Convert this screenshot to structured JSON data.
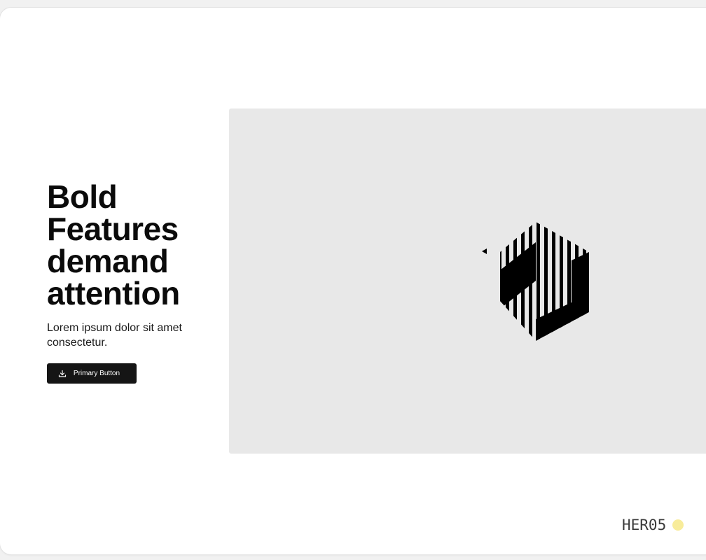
{
  "hero": {
    "headline_lines": [
      "Bold",
      "Features",
      "demand",
      "attention"
    ],
    "subtext": "Lorem ipsum dolor sit amet consectetur.",
    "primary_button_label": "Primary Button",
    "primary_button_icon": "download-icon"
  },
  "media": {
    "background_color": "#e8e8e8",
    "logo_icon": "striped-hexagon-logo"
  },
  "tag": {
    "label": "HER05",
    "dot_color": "#f8ec9a"
  },
  "colors": {
    "text": "#0b0b0b",
    "button_bg": "#151515",
    "button_text": "#ffffff"
  }
}
